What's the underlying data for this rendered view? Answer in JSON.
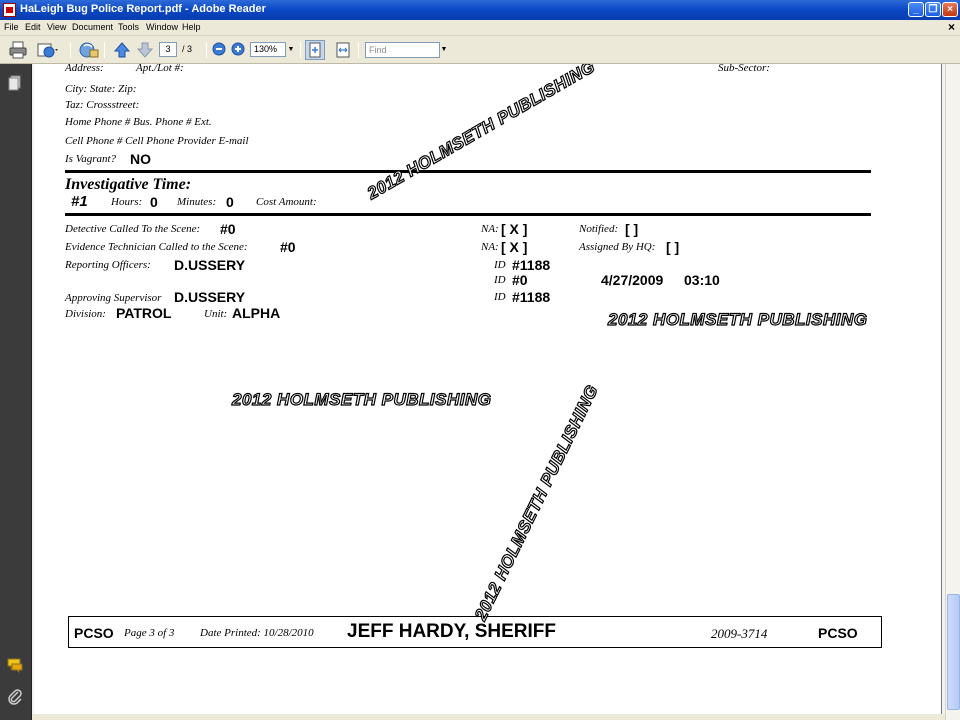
{
  "window": {
    "title": "HaLeigh Bug Police Report.pdf - Adobe Reader",
    "minimize_label": "_",
    "maximize_label": "❐",
    "close_label": "×",
    "doc_close_label": "×"
  },
  "menu": {
    "items": [
      "File",
      "Edit",
      "View",
      "Document",
      "Tools",
      "Window",
      "Help"
    ]
  },
  "toolbar": {
    "current_page": "3",
    "total_pages": "/ 3",
    "zoom": "130%",
    "find_placeholder": "Find"
  },
  "document": {
    "address_line": {
      "address": "Address:",
      "apt": "Apt./Lot #:",
      "sub_sector": "Sub-Sector:"
    },
    "city_line": "City:   State:   Zip:",
    "taz_line": "Taz:   Crossstreet:",
    "phone_line": "Home Phone #  Bus. Phone # Ext.",
    "cell_line": "Cell Phone #   Cell Phone Provider   E-mail",
    "vagrant_label": "Is Vagrant?",
    "vagrant_value": "NO",
    "investigative_heading": "Investigative Time:",
    "inv_number": "#1",
    "hours_label": "Hours:",
    "hours_value": "0",
    "minutes_label": "Minutes:",
    "minutes_value": "0",
    "cost_label": "Cost Amount:",
    "detective_label": "Detective Called To the Scene:",
    "detective_value": "#0",
    "evidence_label": "Evidence Technician Called to the Scene:",
    "evidence_value": "#0",
    "na_label_1": "NA:",
    "na_value_1": "[ X ]",
    "na_label_2": "NA:",
    "na_value_2": "[ X ]",
    "notified_label": "Notified:",
    "notified_value": "[ ]",
    "assigned_label": "Assigned By HQ:",
    "assigned_value": "[ ]",
    "reporting_label": "Reporting Officers:",
    "reporting_value": "D.USSERY",
    "id_label_1": "ID",
    "id_value_1": "#1188",
    "id_label_2": "ID",
    "id_value_2": "#0",
    "date_value": "4/27/2009",
    "time_value": "03:10",
    "approving_label": "Approving Supervisor",
    "approving_value": "D.USSERY",
    "id_label_3": "ID",
    "id_value_3": "#1188",
    "division_label": "Division:",
    "division_value": "PATROL",
    "unit_label": "Unit:",
    "unit_value": "ALPHA",
    "watermark": "2012 HOLMSETH PUBLISHING"
  },
  "footer": {
    "agency_left": "PCSO",
    "page_info": "Page 3  of 3",
    "date_printed": "Date Printed: 10/28/2010",
    "sheriff": "JEFF HARDY, SHERIFF",
    "case_number": "2009-3714",
    "agency_right": "PCSO"
  },
  "icons": [
    "print-icon",
    "email-icon",
    "hand-tool-icon",
    "prev-page-icon",
    "next-page-icon",
    "zoom-out-icon",
    "zoom-in-icon",
    "fit-page-icon",
    "fit-width-icon",
    "pages-icon",
    "comments-icon",
    "attachments-icon"
  ]
}
